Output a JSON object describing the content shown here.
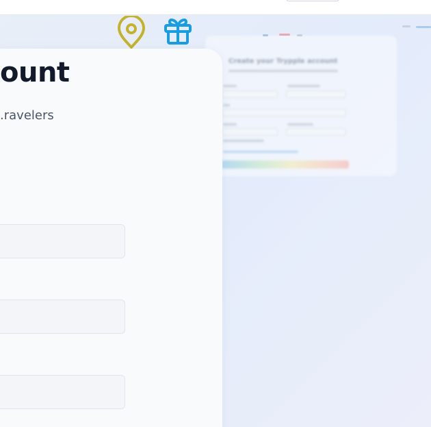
{
  "card": {
    "title": "ount",
    "subtitle": "ravelers."
  },
  "form": {
    "fields": [
      {
        "value": "",
        "placeholder": ""
      },
      {
        "value": "",
        "placeholder": ""
      },
      {
        "value": "",
        "placeholder": ""
      }
    ]
  },
  "background_preview": {
    "title": "Create your Trypple account"
  },
  "icons": {
    "map_pin": {
      "name": "map-pin-icon",
      "color": "#c4b22a"
    },
    "gift": {
      "name": "gift-icon",
      "color": "#1a9de0"
    }
  },
  "colors": {
    "accent": "#1f97e6",
    "title": "#131a2b",
    "body_text": "#4a5468"
  }
}
